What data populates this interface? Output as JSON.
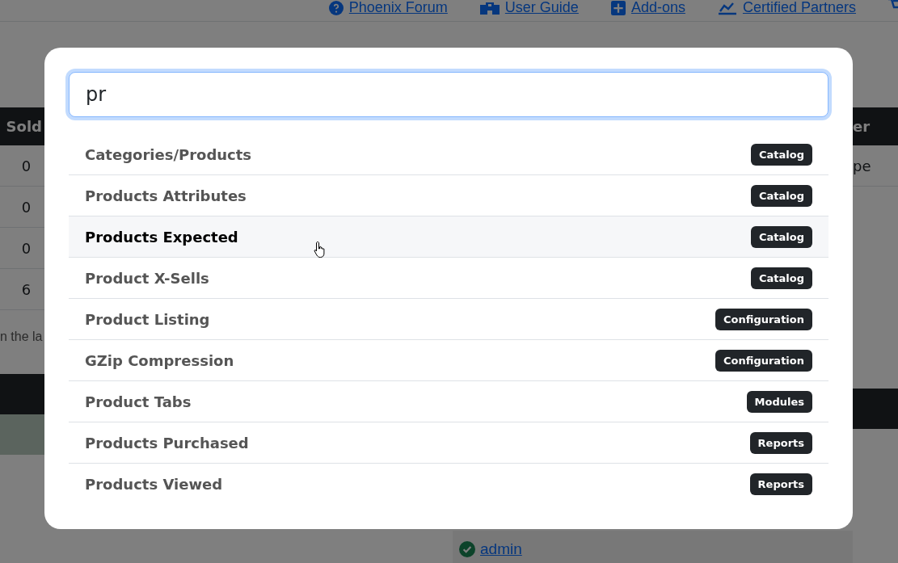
{
  "top_links": [
    {
      "label": "Phoenix Forum"
    },
    {
      "label": "User Guide"
    },
    {
      "label": "Add-ons"
    },
    {
      "label": "Certified Partners"
    }
  ],
  "left_table": {
    "header": "Sold",
    "rows": [
      "0",
      "0",
      "0",
      "6"
    ],
    "note": "n the la"
  },
  "right_table": {
    "header": "er",
    "rows": [
      "pe"
    ]
  },
  "user_link": {
    "label": "admin"
  },
  "search_dialog": {
    "search": {
      "value": "pr"
    },
    "results": [
      {
        "label": "Categories/Products",
        "tag": "Catalog",
        "hovered": false
      },
      {
        "label": "Products Attributes",
        "tag": "Catalog",
        "hovered": false
      },
      {
        "label": "Products Expected",
        "tag": "Catalog",
        "hovered": true
      },
      {
        "label": "Product X-Sells",
        "tag": "Catalog",
        "hovered": false
      },
      {
        "label": "Product Listing",
        "tag": "Configuration",
        "hovered": false
      },
      {
        "label": "GZip Compression",
        "tag": "Configuration",
        "hovered": false
      },
      {
        "label": "Product Tabs",
        "tag": "Modules",
        "hovered": false
      },
      {
        "label": "Products Purchased",
        "tag": "Reports",
        "hovered": false
      },
      {
        "label": "Products Viewed",
        "tag": "Reports",
        "hovered": false
      }
    ]
  }
}
